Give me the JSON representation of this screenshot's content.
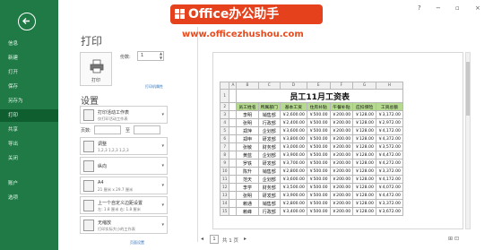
{
  "nav": {
    "items": [
      {
        "label": "信息",
        "active": false
      },
      {
        "label": "新建",
        "active": false
      },
      {
        "label": "打开",
        "active": false
      },
      {
        "label": "保存",
        "active": false
      },
      {
        "label": "另存为",
        "active": false
      },
      {
        "label": "打印",
        "active": true
      },
      {
        "label": "共享",
        "active": false
      },
      {
        "label": "导出",
        "active": false
      },
      {
        "label": "关闭",
        "active": false
      },
      {
        "label": "账户",
        "active": false
      },
      {
        "label": "选项",
        "active": false
      }
    ]
  },
  "print": {
    "title": "打印",
    "print_button_label": "打印",
    "copies_label": "份数:",
    "copies_value": "1",
    "printer_properties": "打印机属性",
    "settings_heading": "设置",
    "settings": [
      {
        "line1": "打印活动工作表",
        "line2": "仅打印活动工作表",
        "icon": "sheet-icon"
      },
      {
        "line1": "调整",
        "line2": "1,2,3    1,2,3    1,2,3",
        "icon": "collate-icon"
      },
      {
        "line1": "纵向",
        "line2": "",
        "icon": "portrait-icon"
      },
      {
        "line1": "A4",
        "line2": "21 厘米 x 29.7 厘米",
        "icon": "paper-size-icon"
      },
      {
        "line1": "上一个自定义边距设置",
        "line2": "左: 1.8 厘米   右: 1.8 厘米",
        "icon": "margins-icon"
      },
      {
        "line1": "无缩放",
        "line2": "打印实际大小的工作表",
        "icon": "scaling-icon"
      }
    ],
    "pages_label": "页数:",
    "pages_to": "至",
    "page_setup_link": "页面设置"
  },
  "preview": {
    "columns": [
      "A",
      "B",
      "C",
      "D",
      "E",
      "F",
      "G",
      "H"
    ],
    "table_title": "员工11月工资表",
    "headers": [
      "员工姓名",
      "所属部门",
      "基本工资",
      "住房补贴",
      "午餐补贴",
      "应扣保险",
      "工资总额"
    ],
    "rows": [
      [
        "李明",
        "销售部",
        "￥2,600.00",
        "￥500.00",
        "￥200.00",
        "￥128.00",
        "￥3,172.00"
      ],
      [
        "张明",
        "行政部",
        "￥2,400.00",
        "￥500.00",
        "￥200.00",
        "￥128.00",
        "￥2,972.00"
      ],
      [
        "郑萍",
        "企划部",
        "￥3,600.00",
        "￥500.00",
        "￥200.00",
        "￥128.00",
        "￥4,172.00"
      ],
      [
        "郑申",
        "研发部",
        "￥3,800.00",
        "￥500.00",
        "￥200.00",
        "￥128.00",
        "￥4,372.00"
      ],
      [
        "张敏",
        "财务部",
        "￥3,000.00",
        "￥500.00",
        "￥200.00",
        "￥128.00",
        "￥3,572.00"
      ],
      [
        "黄蓝",
        "企划部",
        "￥3,900.00",
        "￥500.00",
        "￥200.00",
        "￥128.00",
        "￥4,472.00"
      ],
      [
        "罗铁",
        "研发部",
        "￥3,700.00",
        "￥500.00",
        "￥200.00",
        "￥128.00",
        "￥4,272.00"
      ],
      [
        "陈升",
        "销售部",
        "￥2,800.00",
        "￥500.00",
        "￥200.00",
        "￥128.00",
        "￥3,372.00"
      ],
      [
        "范天",
        "企划部",
        "￥3,600.00",
        "￥500.00",
        "￥200.00",
        "￥128.00",
        "￥4,172.00"
      ],
      [
        "李学",
        "财务部",
        "￥3,500.00",
        "￥500.00",
        "￥200.00",
        "￥128.00",
        "￥4,072.00"
      ],
      [
        "张明",
        "研发部",
        "￥3,900.00",
        "￥500.00",
        "￥200.00",
        "￥128.00",
        "￥4,472.00"
      ],
      [
        "赖通",
        "销售部",
        "￥2,800.00",
        "￥500.00",
        "￥200.00",
        "￥128.00",
        "￥3,372.00"
      ],
      [
        "赖峰",
        "行政部",
        "￥3,400.00",
        "￥500.00",
        "￥200.00",
        "￥128.00",
        "￥3,672.00"
      ]
    ],
    "row_numbers": [
      "1",
      "2",
      "3",
      "4",
      "5",
      "6",
      "7",
      "8",
      "9",
      "10",
      "11",
      "12",
      "13",
      "14",
      "15"
    ],
    "current_page": "1",
    "total_pages": "共 1 页"
  },
  "watermark": {
    "logo_text": "Office办公助手",
    "url": "www.officezhushou.com"
  },
  "window": {
    "help": "?",
    "minimize": "−",
    "restore": "▫",
    "close": "×"
  },
  "colors": {
    "nav_bg": "#1f7a45",
    "nav_active": "#0e5e30",
    "header_fill": "#b5d98f",
    "watermark": "#e4411c"
  }
}
